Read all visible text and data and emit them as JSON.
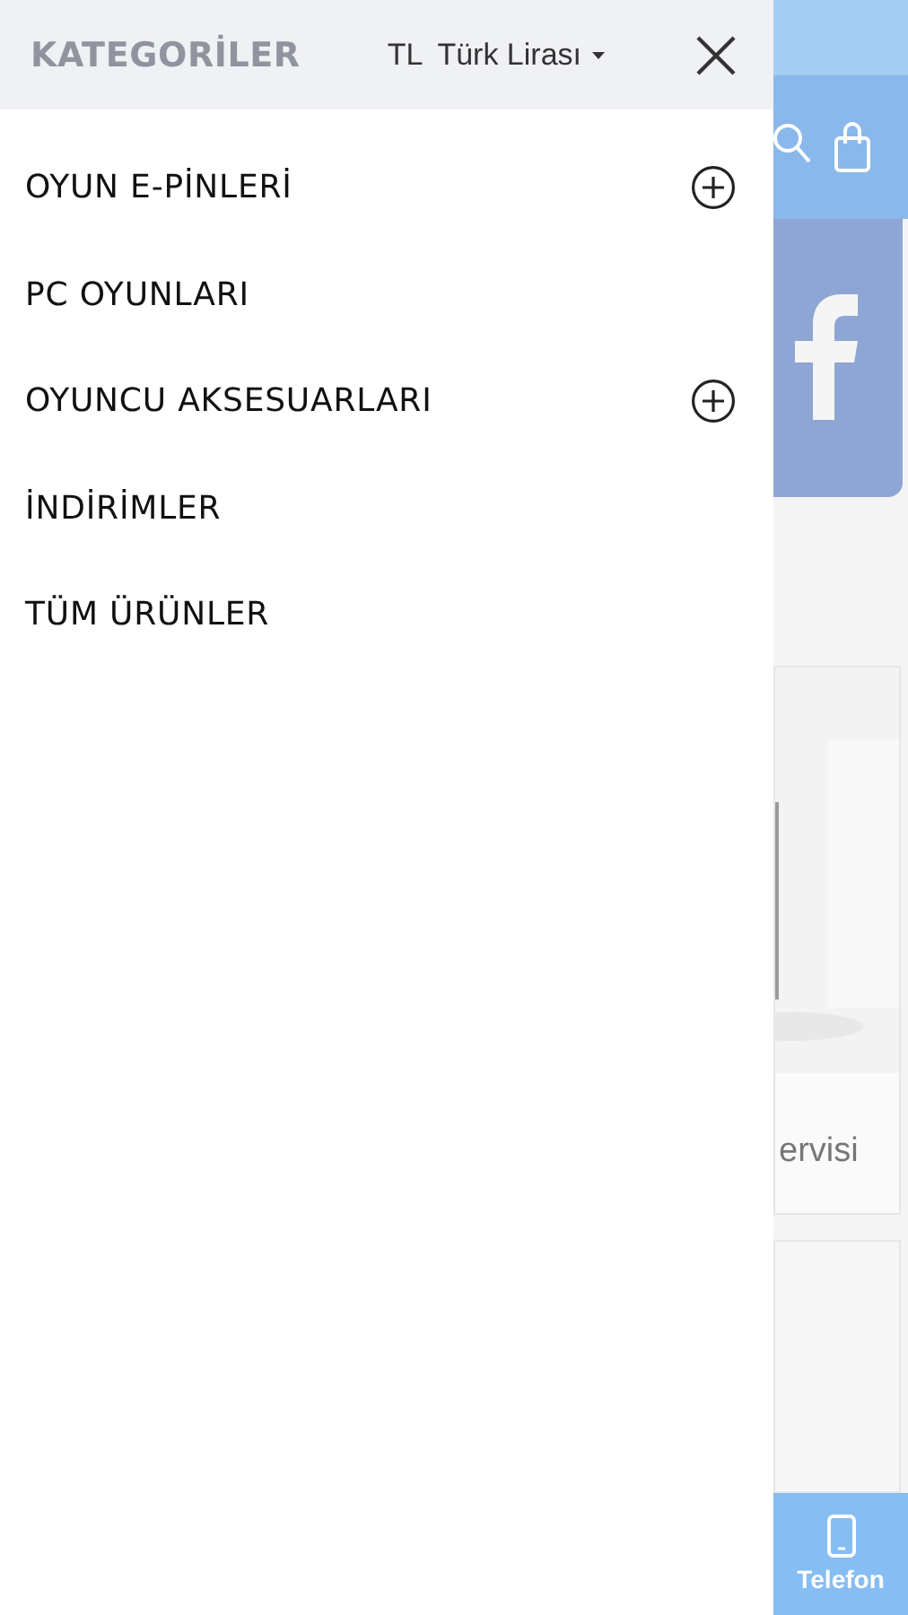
{
  "drawer": {
    "title": "KATEGORİLER",
    "currency": {
      "code": "TL",
      "name": "Türk Lirası"
    },
    "items": [
      {
        "label": "OYUN E-PİNLERİ",
        "expandable": true
      },
      {
        "label": "PC OYUNLARI",
        "expandable": false
      },
      {
        "label": "OYUNCU AKSESUARLARI",
        "expandable": true
      },
      {
        "label": "İNDİRİMLER",
        "expandable": false
      },
      {
        "label": "TÜM ÜRÜNLER",
        "expandable": false
      }
    ]
  },
  "background_page": {
    "card_text": "ervisi",
    "bottom_bar": {
      "label": "Telefon"
    }
  }
}
